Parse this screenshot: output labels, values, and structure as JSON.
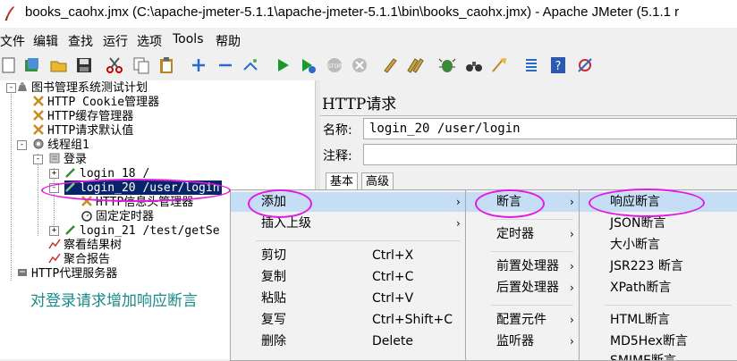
{
  "window": {
    "title": "books_caohx.jmx (C:\\apache-jmeter-5.1.1\\apache-jmeter-5.1.1\\bin\\books_caohx.jmx) - Apache JMeter (5.1.1 r"
  },
  "menubar": [
    "文件",
    "编辑",
    "查找",
    "运行",
    "选项",
    "Tools",
    "帮助"
  ],
  "toolbar_icons": [
    "new-icon",
    "templates-icon",
    "open-icon",
    "save-icon",
    "cut-icon",
    "copy-icon",
    "paste-icon",
    "expand-icon",
    "collapse-icon",
    "toggle-icon",
    "start-icon",
    "start-no-pause-icon",
    "stop-icon",
    "shutdown-icon",
    "clear-icon",
    "clear-all-icon",
    "search-icon",
    "binoculars-icon",
    "reset-search-icon",
    "function-helper-icon",
    "help-icon",
    "remote-icon"
  ],
  "tree": {
    "items": [
      "图书管理系统测试计划",
      "HTTP Cookie管理器",
      "HTTP缓存管理器",
      "HTTP请求默认值",
      "线程组1",
      "登录",
      "login_18 /",
      "login_20 /user/login",
      "HTTP信息头管理器",
      "固定定时器",
      "login_21 /test/getSe",
      "察看结果树",
      "聚合报告",
      "HTTP代理服务器"
    ]
  },
  "caption": "对登录请求增加响应断言",
  "panel": {
    "title": "HTTP请求",
    "name_label": "名称:",
    "name_value": "login_20 /user/login",
    "comment_label": "注释:",
    "tabs": [
      "基本",
      "高级"
    ]
  },
  "context_menu": {
    "items": [
      {
        "label": "添加",
        "shortcut": "",
        "arrow": "›"
      },
      {
        "label": "插入上级",
        "shortcut": "",
        "arrow": "›"
      },
      {
        "label": "剪切",
        "shortcut": "Ctrl+X",
        "arrow": ""
      },
      {
        "label": "复制",
        "shortcut": "Ctrl+C",
        "arrow": ""
      },
      {
        "label": "粘贴",
        "shortcut": "Ctrl+V",
        "arrow": ""
      },
      {
        "label": "复写",
        "shortcut": "Ctrl+Shift+C",
        "arrow": ""
      },
      {
        "label": "删除",
        "shortcut": "Delete",
        "arrow": ""
      }
    ]
  },
  "submenu_add": {
    "items": [
      {
        "label": "断言",
        "arrow": "›"
      },
      {
        "label": "定时器",
        "arrow": "›"
      },
      {
        "label": "前置处理器",
        "arrow": "›"
      },
      {
        "label": "后置处理器",
        "arrow": "›"
      },
      {
        "label": "配置元件",
        "arrow": "›"
      },
      {
        "label": "监听器",
        "arrow": "›"
      }
    ]
  },
  "submenu_assertions": {
    "items": [
      "响应断言",
      "JSON断言",
      "大小断言",
      "JSR223 断言",
      "XPath断言",
      "HTML断言",
      "MD5Hex断言",
      "SMIME断言"
    ]
  },
  "colors": {
    "selection": "#0a246a",
    "highlight": "#c6def5",
    "annotation": "#e21ae2",
    "caption": "#1a8a8a"
  }
}
